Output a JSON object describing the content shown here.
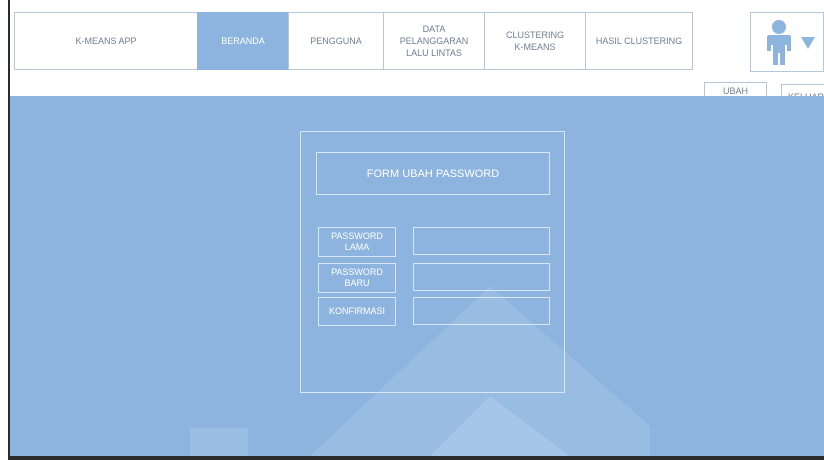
{
  "nav": {
    "app": "K-MEANS APP",
    "beranda": "BERANDA",
    "pengguna": "PENGGUNA",
    "data": "DATA PELANGGARAN LALU LINTAS",
    "clustering": "CLUSTERING K-MEANS",
    "hasil": "HASIL CLUSTERING"
  },
  "user": {
    "icon": "user-icon",
    "dropdown_icon": "caret-down-icon"
  },
  "actions": {
    "ubah_password": "UBAH PASSWORD",
    "keluar": "KELUAR"
  },
  "form": {
    "title": "FORM UBAH PASSWORD",
    "fields": [
      {
        "label": "PASSWORD LAMA",
        "value": ""
      },
      {
        "label": "PASSWORD BARU",
        "value": ""
      },
      {
        "label": "KONFIRMASI",
        "value": ""
      }
    ]
  },
  "colors": {
    "accent": "#8db4de",
    "border": "#b7c7da",
    "text": "#6f7f93"
  }
}
